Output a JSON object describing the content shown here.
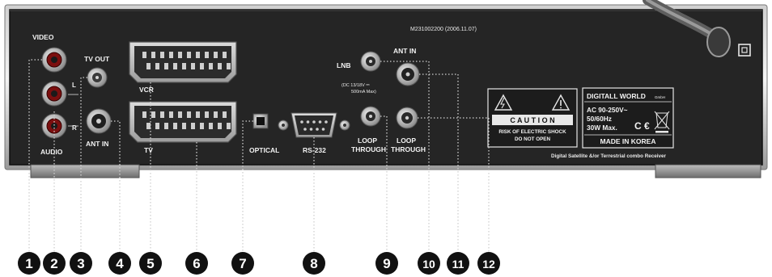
{
  "panel": {
    "model_code": "M231002200 (2006.11.07)",
    "labels": {
      "video": "VIDEO",
      "tv_out": "TV OUT",
      "audio_l": "L",
      "audio_r": "R",
      "audio": "AUDIO",
      "ant_in_left": "ANT IN",
      "vcr": "VCR",
      "tv": "TV",
      "optical": "OPTICAL",
      "rs232": "RS-232",
      "lnb": "LNB",
      "lnb_spec_1": "(DC 13/18V ⎓",
      "lnb_spec_2": "500mA Max)",
      "ant_in_right": "ANT IN",
      "loop_through_1a": "LOOP",
      "loop_through_1b": "THROUGH",
      "loop_through_2a": "LOOP",
      "loop_through_2b": "THROUGH"
    }
  },
  "caution_label": {
    "title": "C A U T I O N",
    "line1": "RISK OF ELECTRIC SHOCK",
    "line2": "DO NOT OPEN"
  },
  "rating_label": {
    "brand": "DIGITALL WORLD",
    "brand_suffix": "GmbH",
    "line1": "AC 90-250V~",
    "line2": "50/60Hz",
    "line3": "30W Max.",
    "ce": "C €",
    "made_in": "MADE IN KOREA"
  },
  "product_line": "Digital Satellite &/or Terrestrial combo Receiver",
  "callouts": [
    "1",
    "2",
    "3",
    "4",
    "5",
    "6",
    "7",
    "8",
    "9",
    "10",
    "11",
    "12"
  ],
  "colors": {
    "panel": "#262626",
    "panel_edge": "#1a1a1a",
    "chrome_light": "#e2e2e2",
    "chrome_dark": "#8a8a8a",
    "label_text": "#f2f2f2",
    "callout": "#111111",
    "leader": "#c8c8c8"
  }
}
